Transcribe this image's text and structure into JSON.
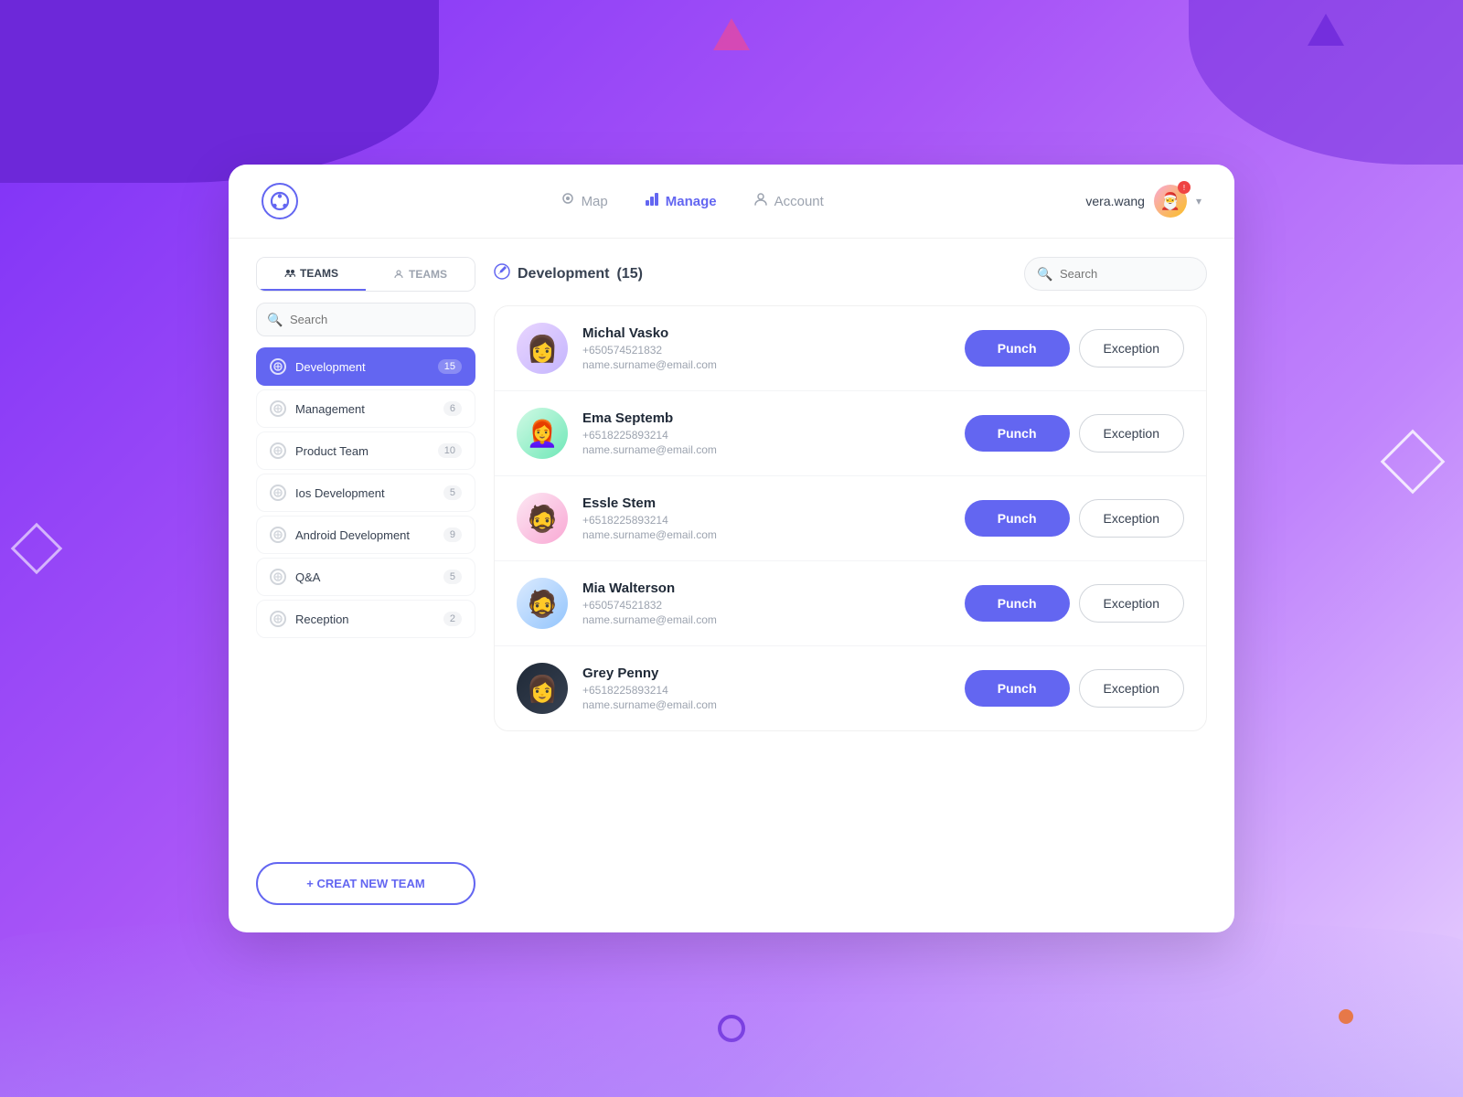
{
  "background": {
    "shapes": []
  },
  "header": {
    "logo_symbol": "⊕",
    "nav": [
      {
        "id": "map",
        "label": "Map",
        "icon": "👤",
        "active": false
      },
      {
        "id": "manage",
        "label": "Manage",
        "icon": "📊",
        "active": true
      },
      {
        "id": "account",
        "label": "Account",
        "icon": "👥",
        "active": false
      }
    ],
    "user": {
      "name": "vera.wang",
      "avatar_emoji": "🎅",
      "chevron": "▾"
    }
  },
  "sidebar": {
    "tab1_label": "TEAMS",
    "tab2_label": "TEAMS",
    "search_placeholder": "Search",
    "teams": [
      {
        "id": "development",
        "name": "Development",
        "count": "15",
        "active": true
      },
      {
        "id": "management",
        "name": "Management",
        "count": "6",
        "active": false
      },
      {
        "id": "product-team",
        "name": "Product Team",
        "count": "10",
        "active": false
      },
      {
        "id": "ios-development",
        "name": "Ios Development",
        "count": "5",
        "active": false
      },
      {
        "id": "android-development",
        "name": "Android Development",
        "count": "9",
        "active": false
      },
      {
        "id": "qa",
        "name": "Q&A",
        "count": "5",
        "active": false
      },
      {
        "id": "reception",
        "name": "Reception",
        "count": "2",
        "active": false
      }
    ],
    "create_btn_label": "+ CREAT NEW TEAM"
  },
  "main": {
    "title": "Development",
    "count": "(15)",
    "search_placeholder": "Search",
    "members": [
      {
        "id": "michal",
        "name": "Michal Vasko",
        "phone": "+650574521832",
        "email": "name.surname@email.com",
        "avatar_class": "avatar-michal",
        "avatar_emoji": "👩"
      },
      {
        "id": "ema",
        "name": "Ema Septemb",
        "phone": "+6518225893214",
        "email": "name.surname@email.com",
        "avatar_class": "avatar-ema",
        "avatar_emoji": "👩‍🦰"
      },
      {
        "id": "essle",
        "name": "Essle Stem",
        "phone": "+6518225893214",
        "email": "name.surname@email.com",
        "avatar_class": "avatar-essle",
        "avatar_emoji": "🧔"
      },
      {
        "id": "mia",
        "name": "Mia Walterson",
        "phone": "+650574521832",
        "email": "name.surname@email.com",
        "avatar_class": "avatar-mia",
        "avatar_emoji": "🧔"
      },
      {
        "id": "grey",
        "name": "Grey Penny",
        "phone": "+6518225893214",
        "email": "name.surname@email.com",
        "avatar_class": "avatar-grey",
        "avatar_emoji": "👩"
      }
    ],
    "punch_label": "Punch",
    "exception_label": "Exception"
  }
}
